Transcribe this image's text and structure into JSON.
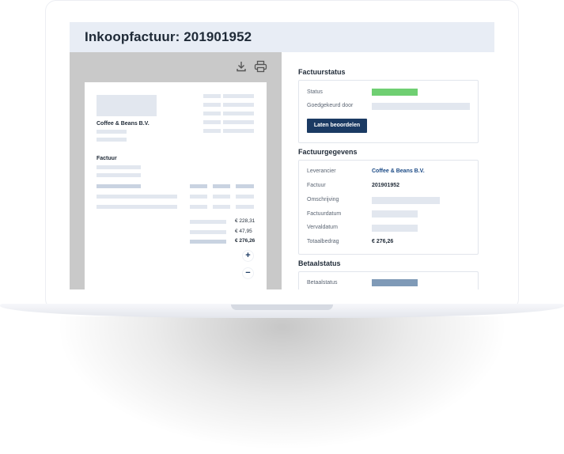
{
  "page_title": "Inkoopfactuur: 201901952",
  "toolbar": {
    "download_icon": "download-icon",
    "print_icon": "printer-icon"
  },
  "document": {
    "company": "Coffee & Beans B.V.",
    "heading": "Factuur",
    "amounts": [
      "€ 228,31",
      "€ 47,95",
      "€ 276,26"
    ],
    "zoom_in": "+",
    "zoom_out": "−"
  },
  "invoice_status": {
    "title": "Factuurstatus",
    "status_label": "Status",
    "status_color": "#6fcf72",
    "approved_by_label": "Goedgekeurd door",
    "review_button": "Laten beoordelen"
  },
  "invoice_details": {
    "title": "Factuurgegevens",
    "rows": [
      {
        "label": "Leverancier",
        "value": "Coffee & Beans B.V."
      },
      {
        "label": "Factuur",
        "value": "201901952"
      },
      {
        "label": "Omschrijving",
        "value": ""
      },
      {
        "label": "Factuurdatum",
        "value": ""
      },
      {
        "label": "Vervaldatum",
        "value": ""
      },
      {
        "label": "Totaalbedrag",
        "value": "€ 276,26"
      }
    ]
  },
  "payment_status": {
    "title": "Betaalstatus",
    "status_label": "Betaalstatus",
    "status_color": "#7f9ab7"
  }
}
